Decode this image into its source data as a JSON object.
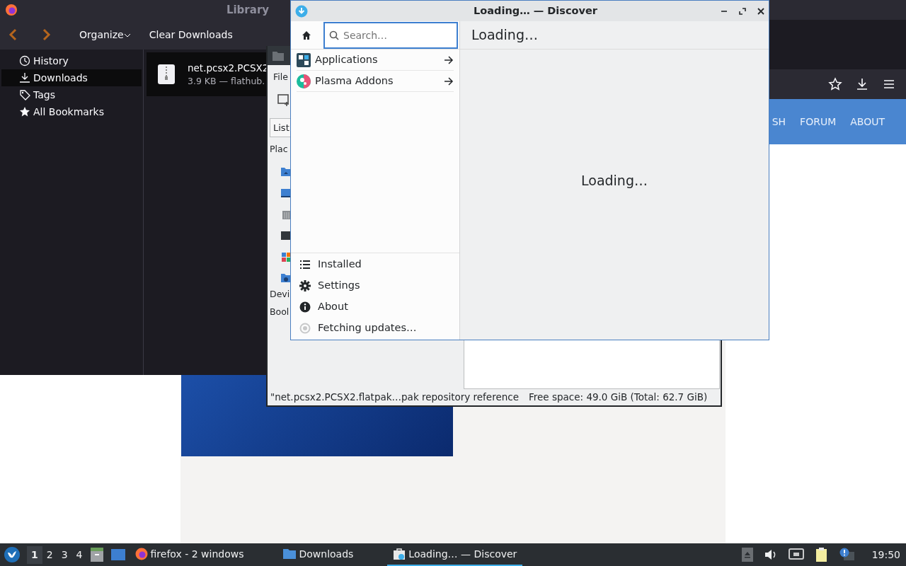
{
  "browser": {
    "nav_links": [
      "SH",
      "FORUM",
      "ABOUT"
    ]
  },
  "library": {
    "title": "Library",
    "toolbar": [
      "Organize",
      "Clear Downloads"
    ],
    "sidebar": [
      {
        "label": "History",
        "kind": "clock",
        "selected": false
      },
      {
        "label": "Downloads",
        "kind": "download",
        "selected": true
      },
      {
        "label": "Tags",
        "kind": "tag",
        "selected": false
      },
      {
        "label": "All Bookmarks",
        "kind": "star",
        "selected": false
      }
    ],
    "downloads": [
      {
        "name": "net.pcsx2.PCSX2",
        "details": "3.9 KB — flathub."
      }
    ]
  },
  "file_manager": {
    "menu": "File",
    "view_button": "List",
    "sections": [
      "Plac",
      "Devi",
      "Bool"
    ],
    "status": "\"net.pcsx2.PCSX2.flatpak…pak repository reference",
    "free_space": "Free space: 49.0 GiB (Total: 62.7 GiB)"
  },
  "discover": {
    "title": "Loading… — Discover",
    "search": {
      "placeholder": "Search…"
    },
    "categories": [
      {
        "label": "Applications",
        "kind": "apps"
      },
      {
        "label": "Plasma Addons",
        "kind": "addons"
      }
    ],
    "header": "Loading…",
    "message": "Loading…",
    "footer": [
      {
        "label": "Installed",
        "kind": "list"
      },
      {
        "label": "Settings",
        "kind": "gear"
      },
      {
        "label": "About",
        "kind": "info"
      },
      {
        "label": "Fetching updates…",
        "kind": "progress"
      }
    ]
  },
  "taskbar": {
    "desktops": [
      {
        "label": "1",
        "selected": true
      },
      {
        "label": "2",
        "selected": false
      },
      {
        "label": "3",
        "selected": false
      },
      {
        "label": "4",
        "selected": false
      }
    ],
    "tasks": [
      {
        "label": "firefox - 2 windows",
        "kind": "firefox",
        "selected": false
      },
      {
        "label": "Downloads",
        "kind": "folder",
        "selected": false
      },
      {
        "label": "Loading… — Discover",
        "kind": "discover",
        "selected": true
      }
    ],
    "clock": "19:50"
  }
}
